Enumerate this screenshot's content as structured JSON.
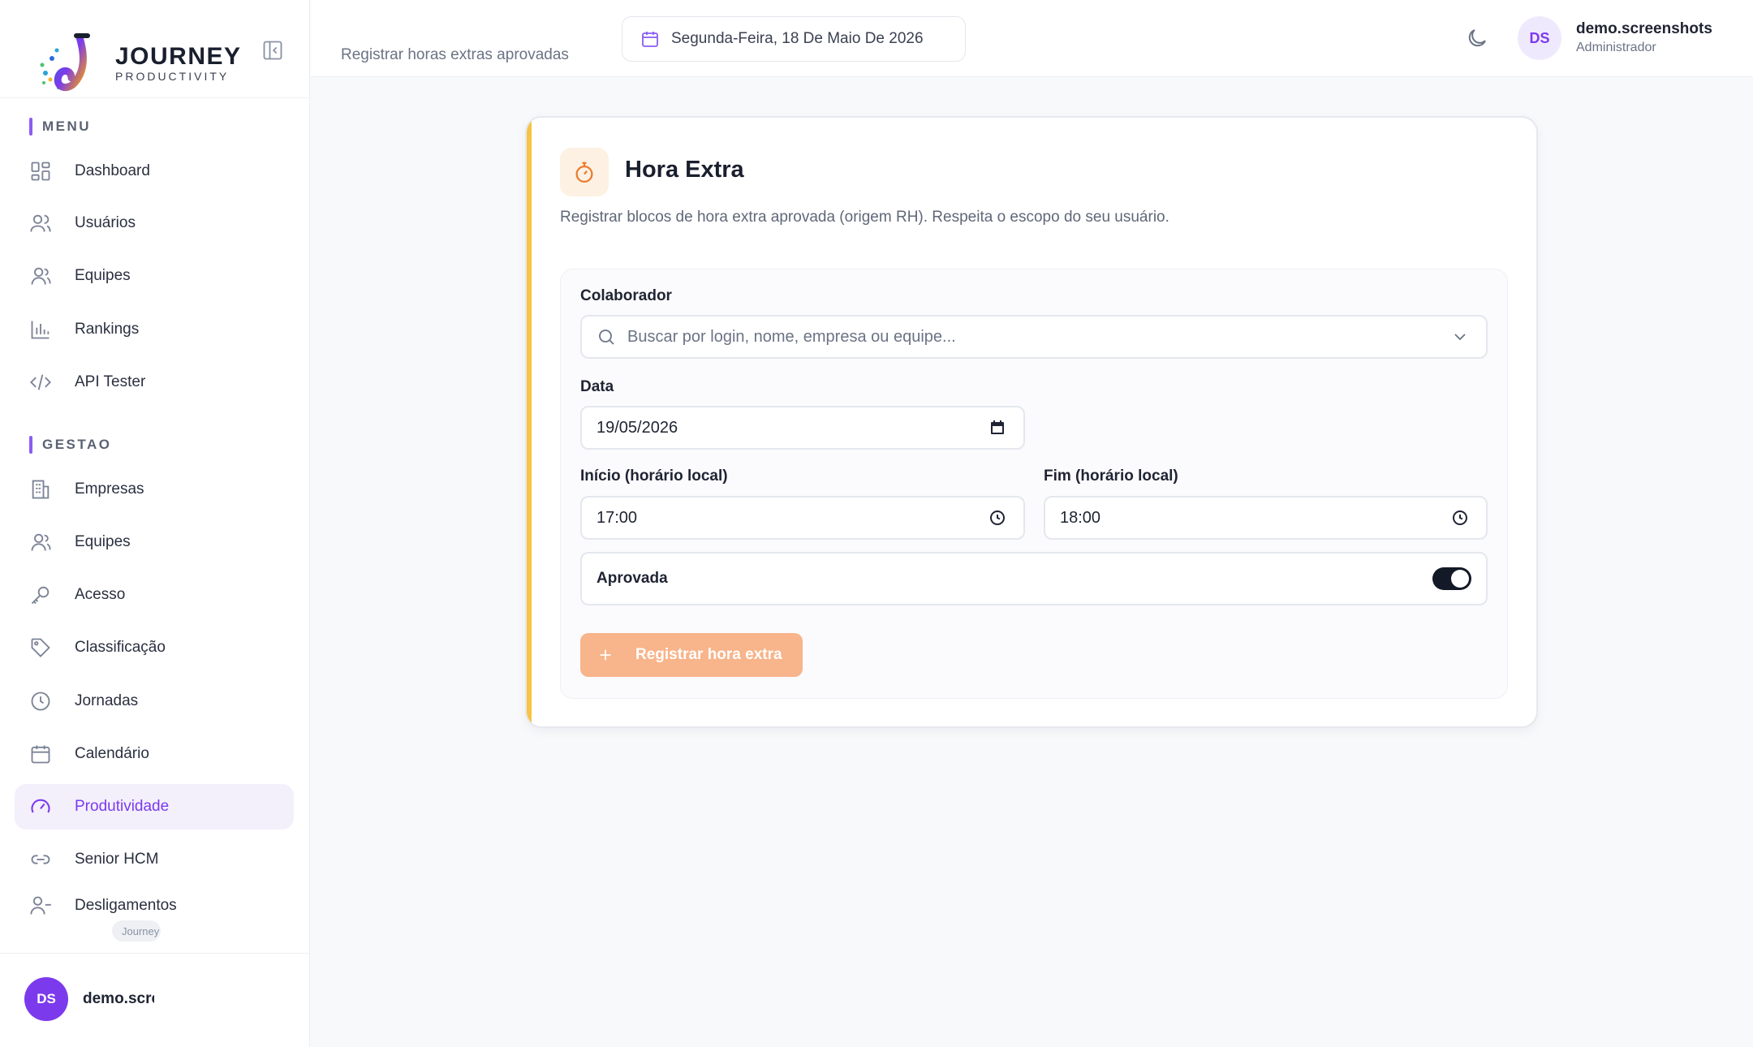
{
  "brand": {
    "name": "JOURNEY",
    "tagline": "PRODUCTIVITY"
  },
  "sidebar": {
    "sections": [
      {
        "label": "MENU",
        "items": [
          {
            "label": "Dashboard",
            "icon": "grid-icon"
          },
          {
            "label": "Usuários",
            "icon": "users-icon"
          },
          {
            "label": "Equipes",
            "icon": "team-icon"
          },
          {
            "label": "Rankings",
            "icon": "bar-chart-icon"
          },
          {
            "label": "API Tester",
            "icon": "code-icon"
          }
        ]
      },
      {
        "label": "GESTAO",
        "items": [
          {
            "label": "Empresas",
            "icon": "building-icon"
          },
          {
            "label": "Equipes",
            "icon": "team-icon"
          },
          {
            "label": "Acesso",
            "icon": "key-icon"
          },
          {
            "label": "Classificação",
            "icon": "tag-icon"
          },
          {
            "label": "Jornadas",
            "icon": "clock-icon"
          },
          {
            "label": "Calendário",
            "icon": "calendar-icon"
          },
          {
            "label": "Produtividade",
            "icon": "gauge-icon",
            "active": true
          },
          {
            "label": "Senior HCM",
            "icon": "link-icon"
          },
          {
            "label": "Desligamentos",
            "icon": "user-minus-icon"
          }
        ]
      }
    ],
    "version_pill": "Journey",
    "user": {
      "initials": "DS",
      "name": "demo.screenshots"
    }
  },
  "header": {
    "subtitle": "Registrar horas extras aprovadas",
    "date": "Segunda-Feira, 18 De Maio De 2026",
    "user": {
      "initials": "DS",
      "name": "demo.screenshots",
      "role": "Administrador"
    }
  },
  "card": {
    "title": "Hora Extra",
    "description": "Registrar blocos de hora extra aprovada (origem RH). Respeita o escopo do seu usuário.",
    "form": {
      "collaborator_label": "Colaborador",
      "collaborator_placeholder": "Buscar por login, nome, empresa ou equipe...",
      "date_label": "Data",
      "date_value": "19/05/2026",
      "start_label": "Início (horário local)",
      "start_value": "17:00",
      "end_label": "Fim (horário local)",
      "end_value": "18:00",
      "approved_label": "Aprovada",
      "approved": true,
      "submit_label": "Registrar hora extra"
    }
  },
  "colors": {
    "accent": "#7c3aed",
    "card_stripe": "#f6c343",
    "submit_button": "#f8b48a",
    "icon_orange": "#ea7a2c"
  }
}
